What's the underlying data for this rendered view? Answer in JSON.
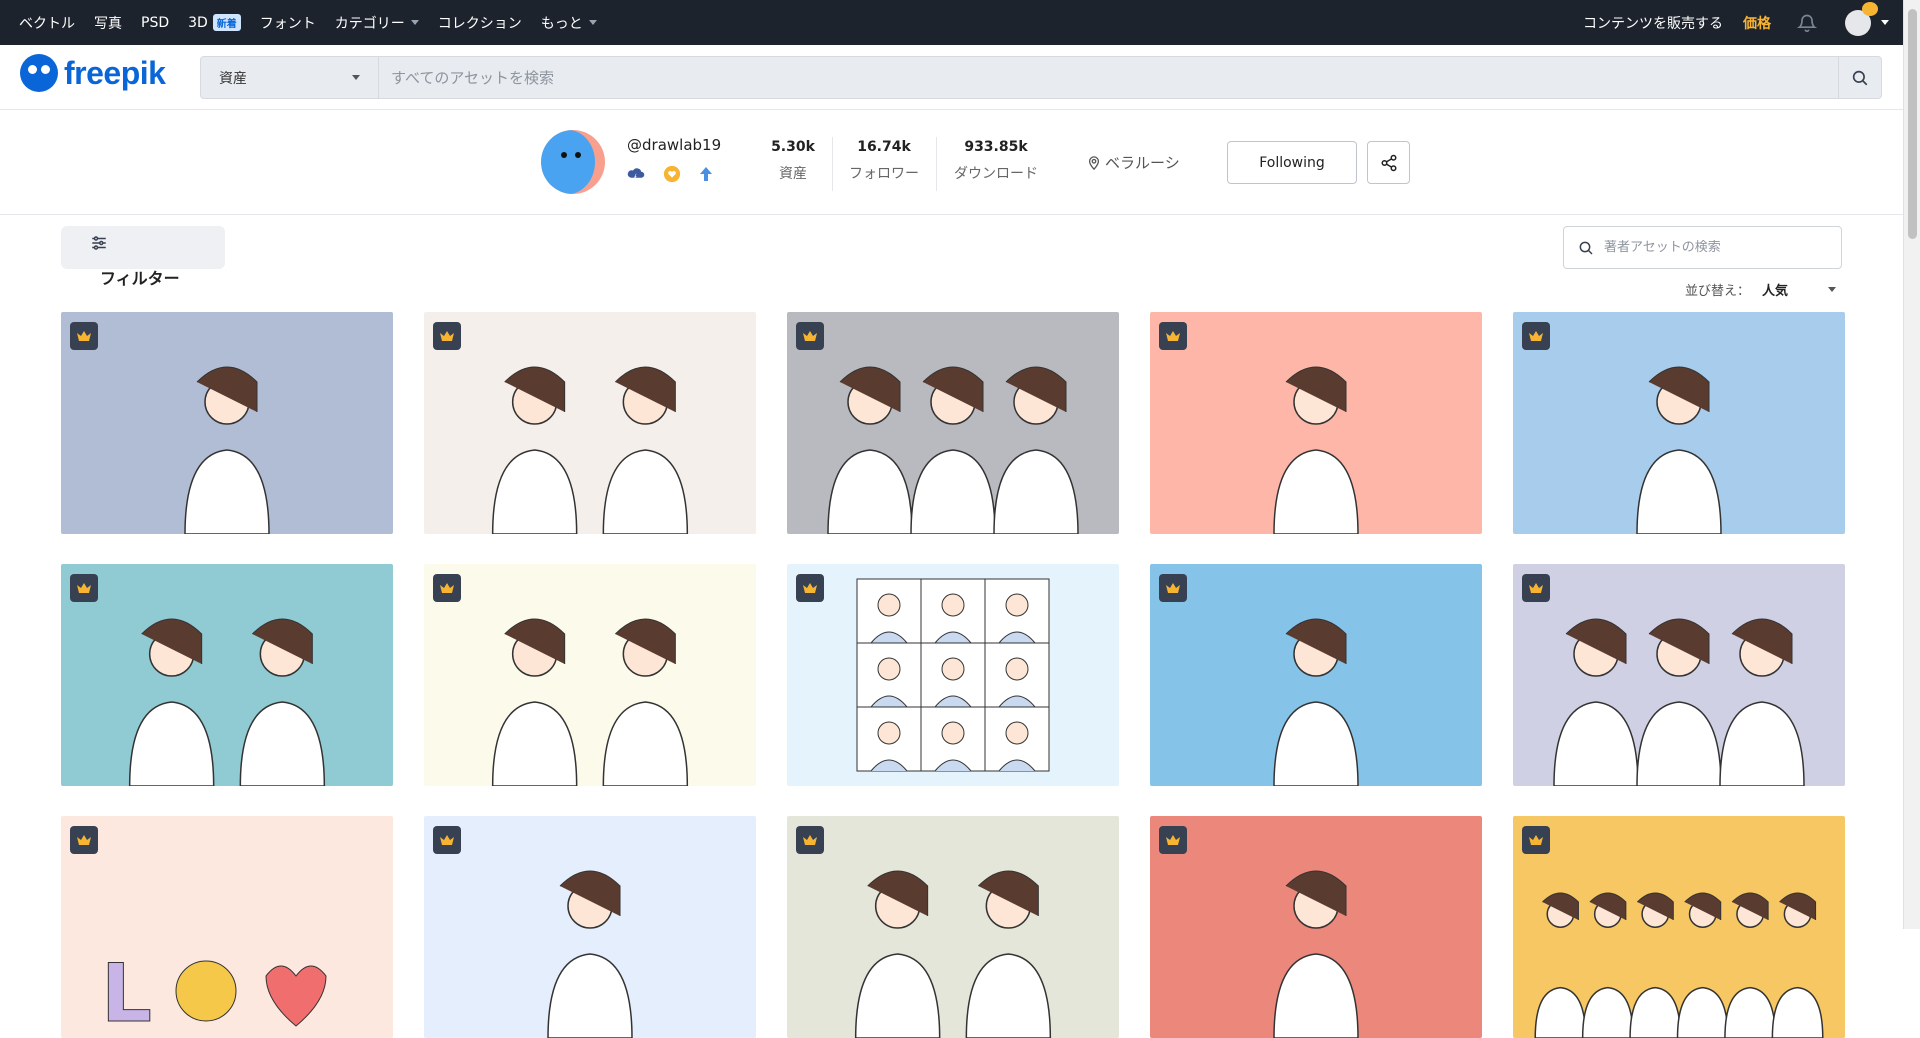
{
  "topbar": {
    "nav": [
      {
        "label": "ベクトル"
      },
      {
        "label": "写真"
      },
      {
        "label": "PSD"
      },
      {
        "label": "3D",
        "badge": "新着"
      },
      {
        "label": "フォント"
      },
      {
        "label": "カテゴリー",
        "dropdown": true
      },
      {
        "label": "コレクション"
      },
      {
        "label": "もっと",
        "dropdown": true
      }
    ],
    "sell_label": "コンテンツを販売する",
    "price_label": "価格",
    "icons": [
      "bell-icon",
      "user-avatar"
    ]
  },
  "header": {
    "logo_text": "freepik",
    "search_type": "資産",
    "search_placeholder": "すべてのアセットを検索"
  },
  "profile": {
    "username": "@drawlab19",
    "stats": [
      {
        "value": "5.30k",
        "label": "資産"
      },
      {
        "value": "16.74k",
        "label": "フォロワー"
      },
      {
        "value": "933.85k",
        "label": "ダウンロード"
      }
    ],
    "location": "ベラルーシ",
    "follow_label": "Following"
  },
  "toolbar": {
    "filter_label": "フィルター",
    "asset_search_placeholder": "著者アセットの検索",
    "sort_label": "並び替え：",
    "sort_value": "人気"
  },
  "colors": {
    "brand": "#0a66d8",
    "topbar_bg": "#1d232d",
    "premium": "#f7b432"
  },
  "cards": [
    {
      "name": "stressed-woman",
      "bg": "#b1bdd5"
    },
    {
      "name": "idea-couple",
      "bg": "#f4efeb"
    },
    {
      "name": "sad-women-rain",
      "bg": "#b8babf"
    },
    {
      "name": "girl-studying-tablet",
      "bg": "#fdb6a8"
    },
    {
      "name": "thinking-woman-lightbulb",
      "bg": "#a7ccec"
    },
    {
      "name": "surprised-women",
      "bg": "#90cad3"
    },
    {
      "name": "couple-hugging",
      "bg": "#fcfbeb"
    },
    {
      "name": "video-call-grid",
      "bg": "#e4f3fc"
    },
    {
      "name": "thumbs-up-person",
      "bg": "#85c3e8"
    },
    {
      "name": "call-center-team",
      "bg": "#cfd0e4"
    },
    {
      "name": "love-letters",
      "bg": "#fde8e0"
    },
    {
      "name": "doctor-online",
      "bg": "#e4eefc"
    },
    {
      "name": "elderly-couple",
      "bg": "#e5e6da"
    },
    {
      "name": "upset-woman",
      "bg": "#ec877c"
    },
    {
      "name": "celebrating-crowd",
      "bg": "#f6c762"
    }
  ]
}
